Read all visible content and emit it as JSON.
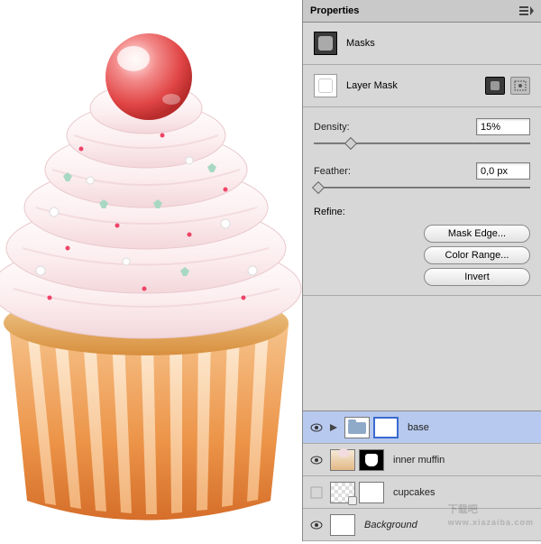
{
  "panel": {
    "title": "Properties",
    "masks": {
      "header": "Masks",
      "type": "Layer Mask"
    },
    "density": {
      "label": "Density:",
      "value": "15%",
      "pos": 15
    },
    "feather": {
      "label": "Feather:",
      "value": "0,0 px",
      "pos": 0
    },
    "refine": {
      "label": "Refine:",
      "mask_edge": "Mask Edge...",
      "color_range": "Color Range...",
      "invert": "Invert"
    }
  },
  "layers": [
    {
      "visible": true,
      "folder": true,
      "expand": true,
      "mask": "sel",
      "name": "base",
      "selected": true
    },
    {
      "visible": true,
      "thumb": "muffin",
      "mask": "dark",
      "name": "inner muffin"
    },
    {
      "visible": false,
      "thumb": "trans",
      "mask": "white",
      "link": true,
      "name": "cupcakes"
    },
    {
      "visible": true,
      "thumb": "white",
      "name": "Background",
      "italic": true
    }
  ],
  "watermark": {
    "main": "下载吧",
    "sub": "www.xiazaiba.com"
  }
}
